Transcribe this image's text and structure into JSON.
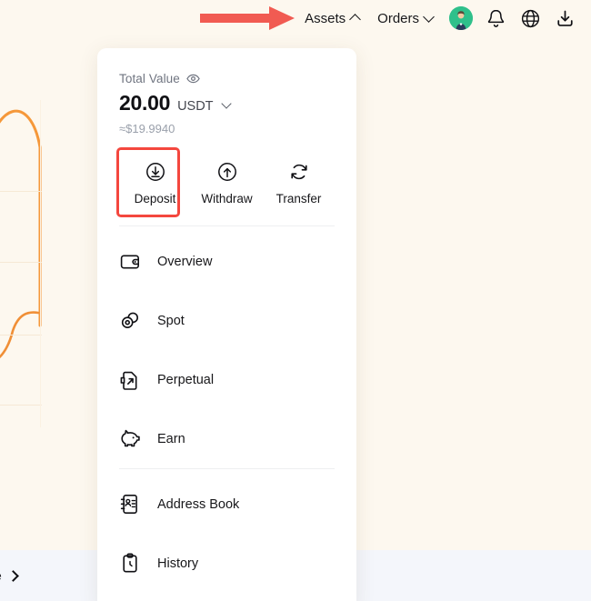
{
  "theme": {
    "page_bg": "#fdf8ef",
    "card_bg": "#ffffff",
    "accent_red": "#f4473e",
    "avatar_green": "#2fc08b",
    "bottom_bar_bg": "#f4f6fb",
    "text_primary": "#17171a",
    "text_muted": "#6f7480"
  },
  "topbar": {
    "assets_label": "Assets",
    "assets_chevron": "chevron-up-icon",
    "orders_label": "Orders",
    "orders_chevron": "chevron-down-icon",
    "avatar_icon": "user-avatar",
    "notification_icon": "bell-icon",
    "language_icon": "globe-icon",
    "download_icon": "download-icon"
  },
  "annotation": {
    "arrow_icon": "red-arrow-right",
    "arrow_color": "#f15b52",
    "highlight_target": "Deposit",
    "highlight_color": "#f4473e"
  },
  "card": {
    "balance": {
      "label": "Total Value",
      "visibility_icon": "eye-icon",
      "amount": "20.00",
      "currency": "USDT",
      "currency_chevron": "chevron-down-icon",
      "approx": "≈$19.9940"
    },
    "actions": [
      {
        "label": "Deposit",
        "icon": "deposit-arrow-down-circle-icon",
        "highlighted": true
      },
      {
        "label": "Withdraw",
        "icon": "withdraw-arrow-up-circle-icon",
        "highlighted": false
      },
      {
        "label": "Transfer",
        "icon": "transfer-refresh-icon",
        "highlighted": false
      }
    ],
    "menu_primary": [
      {
        "label": "Overview",
        "icon": "wallet-icon"
      },
      {
        "label": "Spot",
        "icon": "coins-icon"
      },
      {
        "label": "Perpetual",
        "icon": "contract-arrow-icon"
      },
      {
        "label": "Earn",
        "icon": "piggy-bank-icon"
      }
    ],
    "menu_secondary": [
      {
        "label": "Address Book",
        "icon": "address-book-icon"
      },
      {
        "label": "History",
        "icon": "clipboard-clock-icon"
      }
    ]
  },
  "bottombar": {
    "truncated_text": "e",
    "chevron_icon": "chevron-right-icon"
  }
}
